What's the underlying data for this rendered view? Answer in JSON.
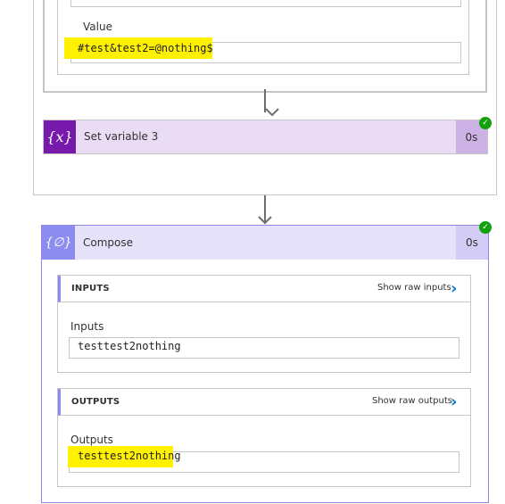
{
  "set_variable_step": {
    "value_label": "Value",
    "value_text": "#test&test2=@nothing$",
    "icon": "variable-icon",
    "icon_glyph": "{x}",
    "title": "Set variable 3",
    "duration": "0s",
    "status": "success"
  },
  "compose_step": {
    "icon": "compose-icon",
    "icon_glyph": "{∅}",
    "title": "Compose",
    "duration": "0s",
    "status": "success",
    "inputs": {
      "section_title": "INPUTS",
      "link": "Show raw inputs",
      "label": "Inputs",
      "value": "testtest2nothing"
    },
    "outputs": {
      "section_title": "OUTPUTS",
      "link": "Show raw outputs",
      "label": "Outputs",
      "value": "testtest2nothing"
    }
  },
  "colors": {
    "variable_icon_bg": "#7719aa",
    "variable_header_bg": "#eadcf5",
    "compose_icon_bg": "#8c8cf0",
    "compose_header_bg": "#e6e2fa",
    "highlight": "#fff200",
    "success": "#13a10e",
    "link_chevron": "#0078d4"
  }
}
